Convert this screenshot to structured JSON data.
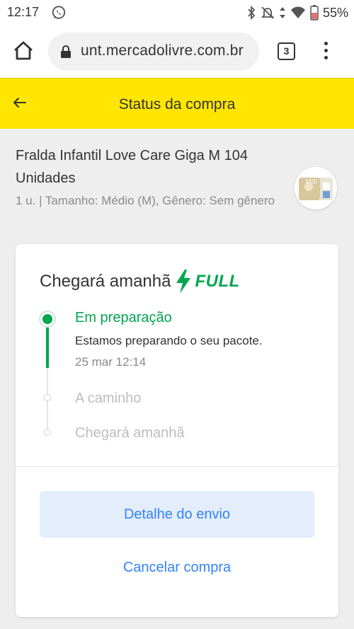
{
  "status_bar": {
    "time": "12:17",
    "battery": "55%"
  },
  "browser": {
    "url": "unt.mercadolivre.com.br",
    "tab_count": "3"
  },
  "header": {
    "title": "Status da compra"
  },
  "product": {
    "name": "Fralda Infantil Love Care Giga M 104 Unidades",
    "meta": "1 u. | Tamanho: Médio (M), Gênero: Sem gênero"
  },
  "shipment": {
    "title": "Chegará amanhã",
    "badge": "FULL",
    "steps": [
      {
        "title": "Em preparação",
        "desc": "Estamos preparando o seu pacote.",
        "date": "25 mar 12:14",
        "active": true
      },
      {
        "title": "A caminho",
        "active": false
      },
      {
        "title": "Chegará amanhã",
        "active": false
      }
    ],
    "details_button": "Detalhe do envio",
    "cancel_link": "Cancelar compra"
  },
  "colors": {
    "brand_yellow": "#ffe600",
    "success_green": "#00a650",
    "link_blue": "#3483fa"
  }
}
